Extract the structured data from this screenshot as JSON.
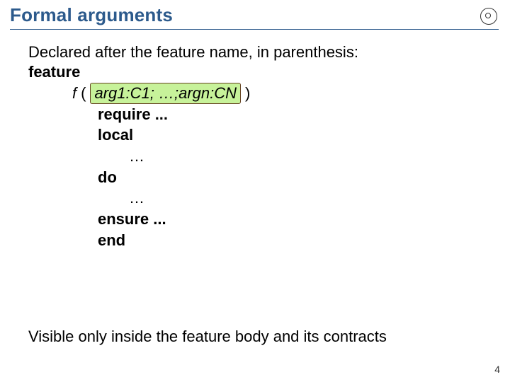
{
  "title": "Formal arguments",
  "intro": "Declared after the feature name, in parenthesis:",
  "feature_kw": "feature",
  "sig": {
    "f": "f",
    "open": "(",
    "arg1": "arg1",
    "colon1": " : ",
    "c1": "C1",
    "sep": " ; …; ",
    "argn": "argn",
    "colon2": " : ",
    "cn": "CN",
    "close": " )"
  },
  "lines": {
    "require": "require ...",
    "local": "local",
    "ell1": "…",
    "do": "do",
    "ell2": "…",
    "ensure": "ensure ...",
    "end": "end"
  },
  "closing": "Visible only inside the feature body and its contracts",
  "pagenum": "4"
}
